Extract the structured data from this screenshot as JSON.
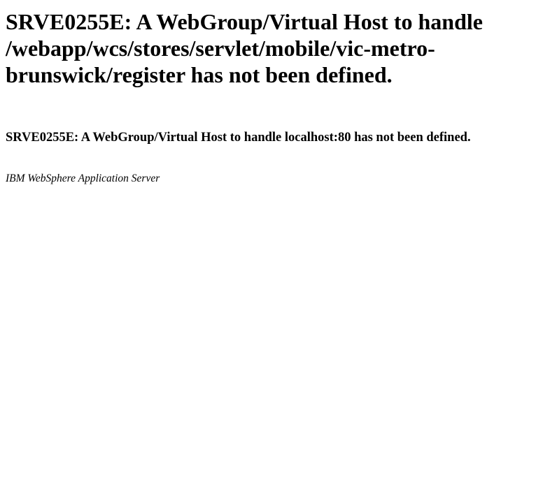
{
  "error": {
    "title": "SRVE0255E: A WebGroup/Virtual Host to handle /webapp/wcs/stores/servlet/mobile/vic-metro-brunswick/register has not been defined.",
    "detail": "SRVE0255E: A WebGroup/Virtual Host to handle localhost:80 has not been defined."
  },
  "footer": {
    "server_name": "IBM WebSphere Application Server"
  }
}
